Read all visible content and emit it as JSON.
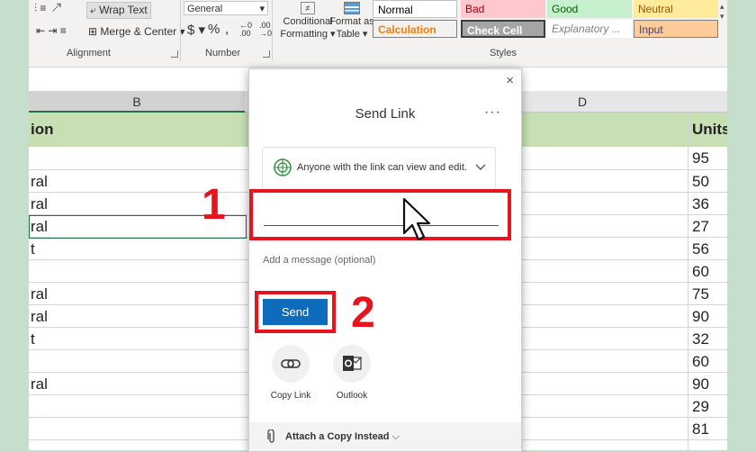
{
  "ribbon": {
    "wrap_text": "Wrap Text",
    "merge_center": "Merge & Center",
    "alignment_label": "Alignment",
    "number_format": "General",
    "currency": "$",
    "percent": "%",
    "comma": ",",
    "number_label": "Number",
    "conditional_formatting_line1": "Conditional",
    "conditional_formatting_line2": "Formatting",
    "format_as_table_line1": "Format as",
    "format_as_table_line2": "Table",
    "styles_label": "Styles",
    "styles": {
      "normal": "Normal",
      "bad": "Bad",
      "good": "Good",
      "neutral": "Neutral",
      "calculation": "Calculation",
      "check_cell": "Check Cell",
      "explanatory": "Explanatory ...",
      "input": "Input"
    }
  },
  "sheet": {
    "col_b": "B",
    "col_d": "D",
    "header_left": "ion",
    "header_right": "Units",
    "left_cells": [
      "",
      "ral",
      "ral",
      "ral",
      "t",
      "",
      "ral",
      "ral",
      "t",
      "",
      "ral",
      "",
      "",
      ""
    ],
    "units": [
      "95",
      "50",
      "36",
      "27",
      "56",
      "60",
      "75",
      "90",
      "32",
      "60",
      "90",
      "29",
      "81",
      ""
    ]
  },
  "dialog": {
    "title": "Send Link",
    "more": "···",
    "close": "×",
    "permission": "Anyone with the link can view and edit.",
    "to_placeholder": "",
    "message_placeholder": "Add a message (optional)",
    "send": "Send",
    "copy_link": "Copy Link",
    "outlook": "Outlook",
    "attach": "Attach a Copy Instead"
  },
  "annotations": {
    "step1": "1",
    "step2": "2"
  },
  "colors": {
    "accent": "#0f6cbd",
    "highlight": "#e5141d",
    "header_green": "#c6e0b4"
  }
}
